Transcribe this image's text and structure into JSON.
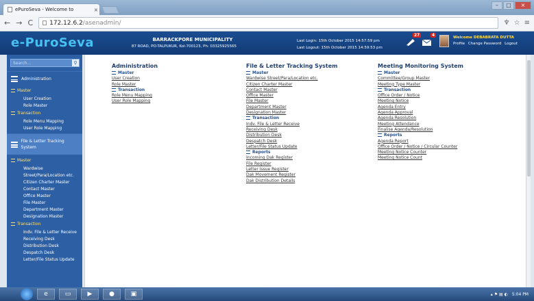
{
  "browser": {
    "tab_title": "ePuroSeva - Welcome to",
    "url_host": "172.12.6.2",
    "url_path": "/asenadmin/"
  },
  "header": {
    "logo": "e-PuroSeva",
    "municipality": "BARRACKPORE MUNICIPALITY",
    "address": "87 ROAD, PO-TALPUKUR, Kol-700123, Ph: 03325925565",
    "last_login": "Last Login: 15th October 2015 14:57:59 pm",
    "last_logout": "Last Logout: 15th October 2015 14:59:53 pm",
    "notif_count": "27",
    "mail_count": "4",
    "welcome": "Welcome DEBABRATA DUTTA",
    "profile": "Profile",
    "change_password": "Change Password",
    "logout": "Logout"
  },
  "sidebar": {
    "search_placeholder": "Search...",
    "administration": "Administration",
    "master": "Master",
    "user_creation": "User Creation",
    "role_master": "Role Master",
    "transaction": "Transaction",
    "role_menu_mapping": "Role Menu Mapping",
    "user_role_mapping": "User Role Mapping",
    "fl_tracking": "File & Letter Tracking System",
    "master2": "Master",
    "items_master": [
      "Wardwise",
      "Street/Para/Location etc.",
      "Citizen Charter Master",
      "Contact Master",
      "Office Master",
      "File Master",
      "Department Master",
      "Designation Master"
    ],
    "transaction2": "Transaction",
    "items_transaction": [
      "Indv. File & Letter Receive",
      "Receiving Desk",
      "Distribution Desk",
      "Despatch Desk",
      "Letter/File Status Update"
    ]
  },
  "columns": {
    "admin": {
      "title": "Administration",
      "master": "Master",
      "master_items": [
        "User Creation",
        "Role Master"
      ],
      "transaction": "Transaction",
      "transaction_items": [
        "Role Menu Mapping",
        "User Role Mapping"
      ]
    },
    "fl": {
      "title": "File & Letter Tracking System",
      "master": "Master",
      "master_items": [
        "Wardwise Street/Para/Location etc.",
        "Citizen Charter Master",
        "Contact Master",
        "Office Master",
        "File Master",
        "Department Master",
        "Designation Master"
      ],
      "transaction": "Transaction",
      "transaction_items": [
        "Indv. File & Letter Receive",
        "Receiving Desk",
        "Distribution Desk",
        "Despatch Desk",
        "Letter/File Status Update"
      ],
      "reports": "Reports",
      "report_items": [
        "Incoming Dak Register",
        "File Register",
        "Letter Issue Register",
        "Dak Movement Register",
        "Dak Distribution Details"
      ]
    },
    "mm": {
      "title": "Meeting Monitoring System",
      "master": "Master",
      "master_items": [
        "Committee/Group Master",
        "Meeting Type Master"
      ],
      "transaction": "Transaction",
      "transaction_items": [
        "Office Order / Notice",
        "Meeting Notice",
        "Agenda Entry",
        "Agenda Approval",
        "Agenda Resolution",
        "Meeting Attendance",
        "Finalise Agenda/Resolution"
      ],
      "reports": "Reports",
      "report_items": [
        "Agenda Report",
        "Office Order / Notice / Circular Counter",
        "Meeting Notice Counter",
        "Meeting Notice Count"
      ]
    }
  },
  "taskbar": {
    "time": "5:04 PM"
  }
}
